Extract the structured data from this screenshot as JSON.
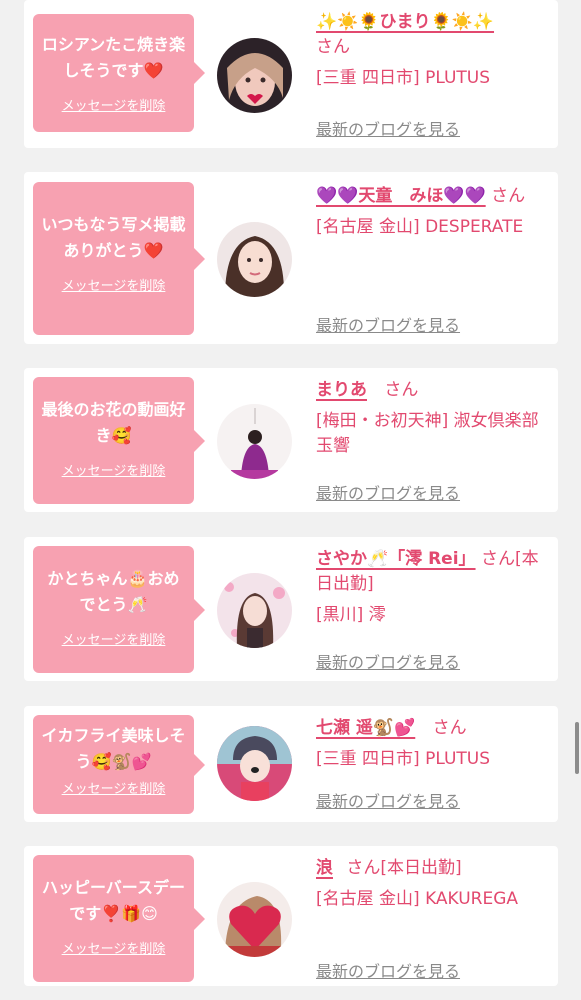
{
  "messages": [
    {
      "text": "ロシアンたこ焼き楽しそうです❤️",
      "delete_label": "メッセージを削除",
      "name": "✨☀️🌻ひまり🌻☀️✨",
      "san": "さん",
      "shop": "[三重 四日市] PLUTUS",
      "blog_label": "最新のブログを見る"
    },
    {
      "text": "いつもなう写メ掲載ありがとう❤️",
      "delete_label": "メッセージを削除",
      "name": "💜💜天童　みほ💜💜",
      "san": "さん",
      "shop": "[名古屋 金山] DESPERATE",
      "blog_label": "最新のブログを見る"
    },
    {
      "text": "最後のお花の動画好き🥰",
      "delete_label": "メッセージを削除",
      "name": "まりあ",
      "san": "さん",
      "shop": "[梅田・お初天神] 淑女倶楽部 玉響",
      "blog_label": "最新のブログを見る"
    },
    {
      "text": "かとちゃん🎂おめでとう🥂",
      "delete_label": "メッセージを削除",
      "name": "さやか🥂「澪 Rei」",
      "san": "さん[本日出勤]",
      "shop": "[黒川] 澪",
      "blog_label": "最新のブログを見る"
    },
    {
      "text": "イカフライ美味しそう🥰🐒💕",
      "delete_label": "メッセージを削除",
      "name": "七瀬 遥🐒💕",
      "san": "さん",
      "shop": "[三重 四日市] PLUTUS",
      "blog_label": "最新のブログを見る"
    },
    {
      "text": "ハッピーバースデーです❣️🎁😊",
      "delete_label": "メッセージを削除",
      "name": "浪",
      "san": "さん[本日出勤]",
      "shop": "[名古屋 金山] KAKUREGA",
      "blog_label": "最新のブログを見る"
    }
  ],
  "colors": {
    "bubble": "#f7a1b1",
    "accent": "#e2496f",
    "link_gray": "#8a8a8a",
    "background": "#f1f1f1"
  }
}
